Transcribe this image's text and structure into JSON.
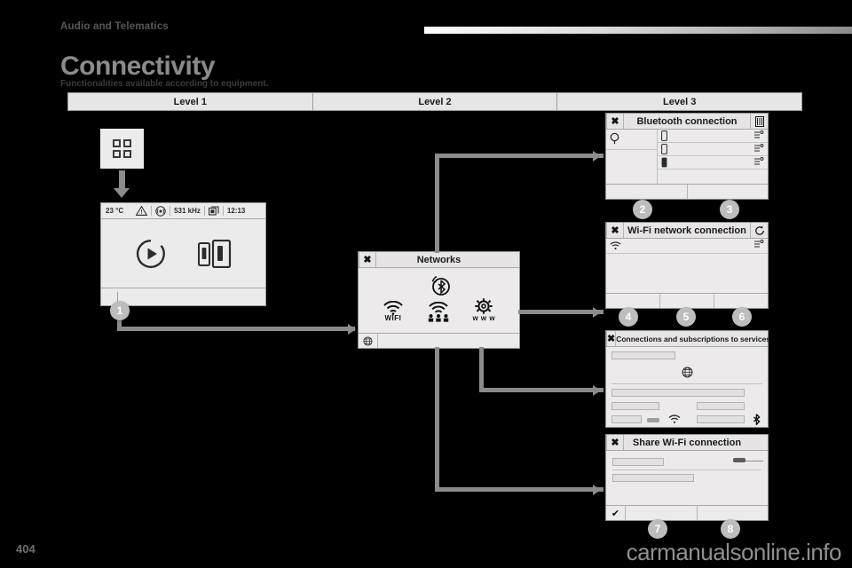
{
  "header": {
    "section": "Audio and Telematics",
    "title": "Connectivity",
    "subtitle": "Functionalities available according to equipment."
  },
  "levels": [
    {
      "label": "Level 1"
    },
    {
      "label": "Level 2"
    },
    {
      "label": "Level 3"
    }
  ],
  "car_display": {
    "menu_tile_icon": "apps-grid-icon",
    "status": {
      "temperature": "23 °C",
      "warning_icon": "warning-triangle-icon",
      "media_icon": "radio-antenna-icon",
      "frequency": "531 kHz",
      "source_icon": "media-stack-icon",
      "time": "12:13"
    },
    "main_icons": [
      "play-circle-icon",
      "phone-pair-icon"
    ]
  },
  "networks_screen": {
    "close_label": "✖",
    "title": "Networks",
    "bluetooth_icon": "bluetooth-signal-icon",
    "items": [
      {
        "icon": "wifi-icon",
        "label": "WIFI"
      },
      {
        "icon": "wifi-users-icon",
        "label": ""
      },
      {
        "icon": "gear-www-icon",
        "label": "w w w"
      }
    ],
    "footer_icon": "globe-icon"
  },
  "bluetooth_screen": {
    "close_label": "✖",
    "title": "Bluetooth connection",
    "trash_icon": "trash-icon",
    "search_icon": "search-icon",
    "rows": [
      {
        "icon": "phone-icon",
        "right_icon": "bt-device-icon"
      },
      {
        "icon": "phone-icon",
        "right_icon": "bt-device-icon"
      },
      {
        "icon": "phone-filled-icon",
        "right_icon": "bt-device-icon"
      }
    ]
  },
  "wifi_screen": {
    "close_label": "✖",
    "title": "Wi-Fi network connection",
    "refresh_icon": "refresh-icon",
    "rows": [
      {
        "icon": "wifi-icon",
        "right_icon": "wifi-device-icon"
      }
    ]
  },
  "services_screen": {
    "close_label": "✖",
    "title": "Connections and subscriptions to services",
    "globe_icon": "globe-icon",
    "wifi_icon": "wifi-icon",
    "bluetooth_icon": "bluetooth-icon",
    "toggle_icon": "toggle-switch-icon"
  },
  "share_screen": {
    "close_label": "✖",
    "title": "Share Wi-Fi connection",
    "toggle_icon": "toggle-switch-icon",
    "check_label": "✔"
  },
  "callouts": [
    {
      "n": "1"
    },
    {
      "n": "2"
    },
    {
      "n": "3"
    },
    {
      "n": "4"
    },
    {
      "n": "5"
    },
    {
      "n": "6"
    },
    {
      "n": "7"
    },
    {
      "n": "8"
    }
  ],
  "footer": {
    "page_number": "404",
    "watermark": "carmanualsonline.info"
  },
  "colors": {
    "background": "#000000",
    "panel": "#eceaea",
    "connector": "#8b8b8b",
    "title": "#8b8b8b",
    "callout": "#bdbdbd"
  }
}
